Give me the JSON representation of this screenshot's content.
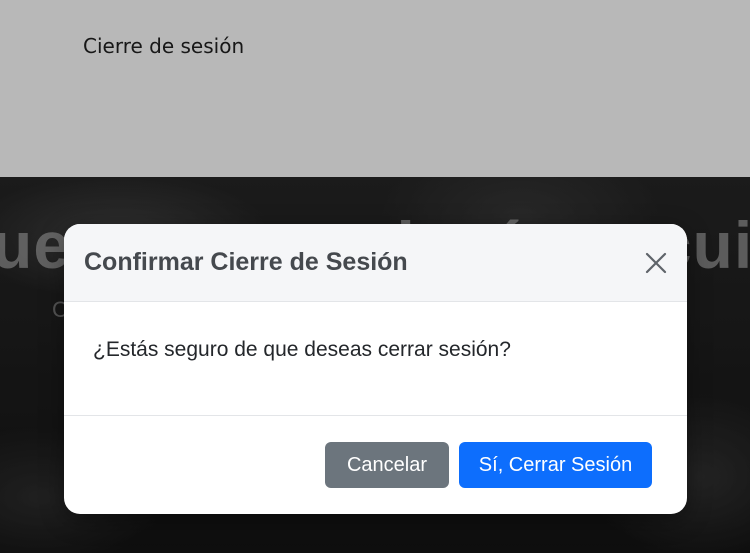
{
  "page": {
    "title": "Cierre de sesión"
  },
  "hero": {
    "heading": "uestra tecnología te cuidamos hogar",
    "subtext": "C"
  },
  "modal": {
    "title": "Confirmar Cierre de Sesión",
    "close_icon": "close-icon",
    "message": "¿Estás seguro de que deseas cerrar sesión?",
    "cancel_label": "Cancelar",
    "confirm_label": "Sí, Cerrar Sesión"
  },
  "colors": {
    "confirm_button": "#0d6efd",
    "cancel_button": "#6c757d",
    "modal_header_bg": "#f5f6f8",
    "title_text": "#45494e"
  }
}
